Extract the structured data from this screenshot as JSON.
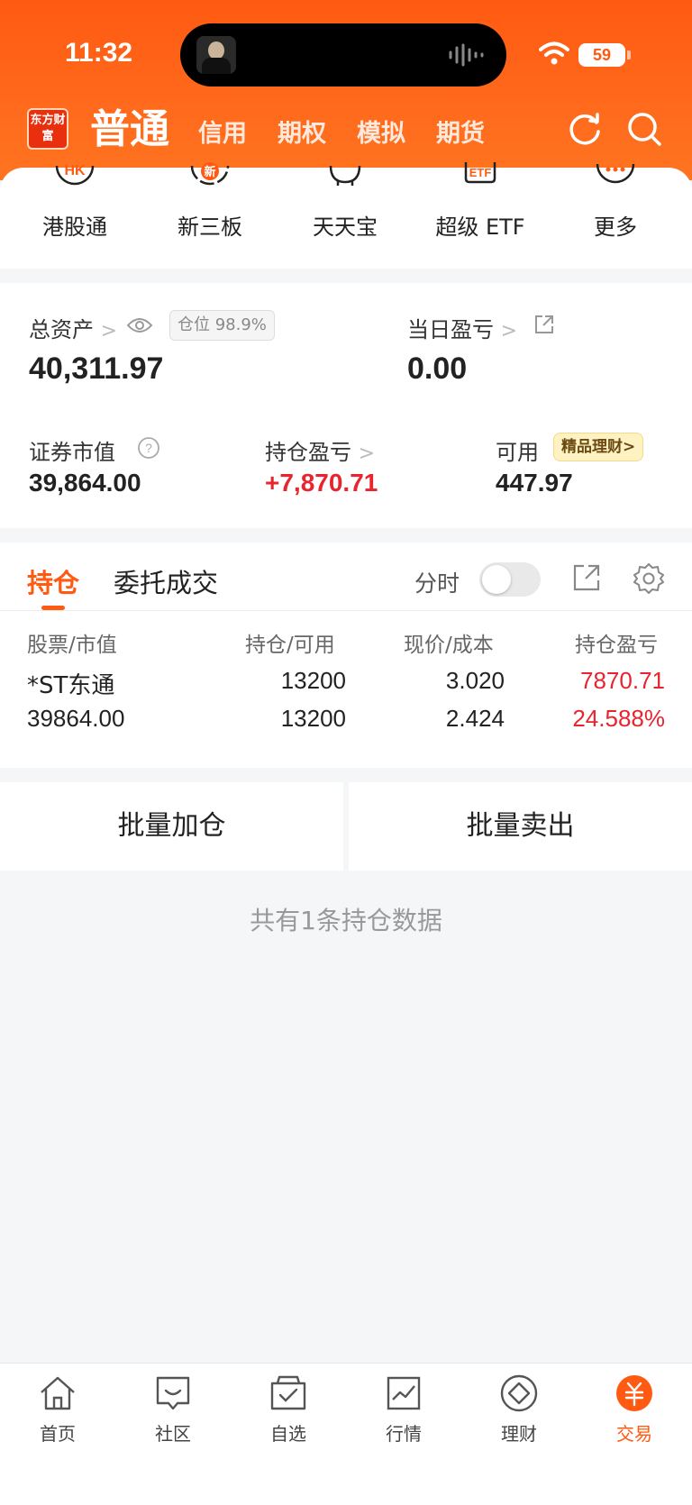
{
  "status_bar": {
    "time": "11:32",
    "battery": "59"
  },
  "header": {
    "logo_text": "东方财富",
    "tabs": [
      "普通",
      "信用",
      "期权",
      "模拟",
      "期货"
    ],
    "colors": {
      "brand": "#ff5a12"
    }
  },
  "quick_nav": [
    {
      "label": "港股通",
      "icon": "hk-icon",
      "icon_text": "HK"
    },
    {
      "label": "新三板",
      "icon": "xin-icon",
      "icon_text": "新"
    },
    {
      "label": "天天宝",
      "icon": "piggy-bank-icon",
      "icon_text": ""
    },
    {
      "label": "超级 ETF",
      "icon": "etf-icon",
      "icon_text": "ETF"
    },
    {
      "label": "更多",
      "icon": "more-icon",
      "icon_text": ""
    }
  ],
  "assets": {
    "total_label": "总资产",
    "position_ratio": "仓位 98.9%",
    "total_value": "40,311.97",
    "daily_pl_label": "当日盈亏",
    "daily_pl_value": "0.00",
    "market_value_label": "证券市值",
    "market_value": "39,864.00",
    "holding_pl_label": "持仓盈亏",
    "holding_pl_value": "+7,870.71",
    "available_label": "可用",
    "available_badge": "精品理财>",
    "available_value": "447.97"
  },
  "positions": {
    "tabs": [
      "持仓",
      "委托成交"
    ],
    "toggle_label": "分时",
    "columns": [
      "股票/市值",
      "持仓/可用",
      "现价/成本",
      "持仓盈亏"
    ],
    "rows": [
      {
        "name": "*ST东通",
        "market_value": "39864.00",
        "holding": "13200",
        "available": "13200",
        "price": "3.020",
        "cost": "2.424",
        "pl": "7870.71",
        "pl_pct": "24.588%"
      }
    ],
    "batch_add": "批量加仓",
    "batch_sell": "批量卖出",
    "summary": "共有1条持仓数据"
  },
  "bottom_nav": [
    {
      "label": "首页",
      "icon": "home-icon"
    },
    {
      "label": "社区",
      "icon": "community-icon"
    },
    {
      "label": "自选",
      "icon": "watchlist-icon"
    },
    {
      "label": "行情",
      "icon": "market-icon"
    },
    {
      "label": "理财",
      "icon": "wealth-icon"
    },
    {
      "label": "交易",
      "icon": "trade-icon",
      "active": true
    }
  ]
}
